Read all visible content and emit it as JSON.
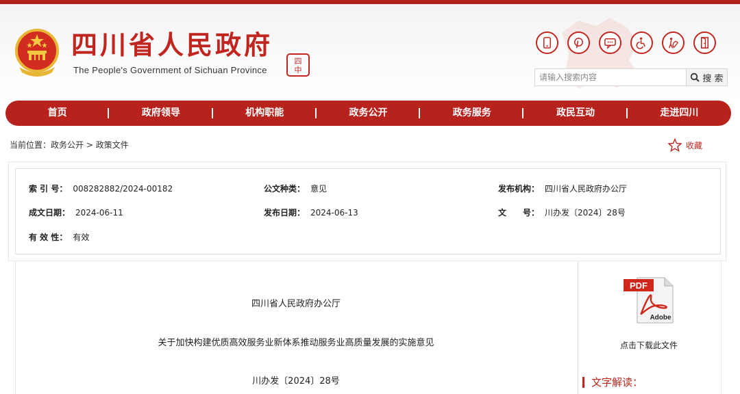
{
  "header": {
    "title": "四川省人民政府",
    "subtitle": "The People's Government of Sichuan Province",
    "seal_chars": [
      "四",
      "川",
      "中",
      "國"
    ],
    "brand_color": "#c0261f",
    "tools": [
      {
        "icon": "mobile-icon"
      },
      {
        "icon": "pinterest-icon"
      },
      {
        "icon": "chat-icon"
      },
      {
        "icon": "accessibility-icon"
      },
      {
        "icon": "elderly-care-icon"
      },
      {
        "icon": "exit-door-icon"
      }
    ],
    "search": {
      "placeholder": "请输入搜索内容",
      "button_label": "搜 索"
    }
  },
  "nav": {
    "items": [
      "首页",
      "政府领导",
      "机构职能",
      "政务公开",
      "政务服务",
      "政民互动",
      "走进四川"
    ],
    "background": "#b8221c"
  },
  "breadcrumb": {
    "prefix": "当前位置：",
    "items": [
      "政务公开",
      "政策文件"
    ],
    "separator": ">"
  },
  "favorite": {
    "label": "收藏",
    "icon": "star-icon"
  },
  "meta": {
    "index_no": {
      "label": "索 引 号：",
      "value": "008282882/2024-00182"
    },
    "doc_type": {
      "label": "公文种类：",
      "value": "意见"
    },
    "issuer": {
      "label": "发布机构：",
      "value": "四川省人民政府办公厅"
    },
    "created_date": {
      "label": "成文日期：",
      "value": "2024-06-11"
    },
    "publish_date": {
      "label": "发布日期：",
      "value": "2024-06-13"
    },
    "doc_no": {
      "label": "文　　号：",
      "value": "川办发〔2024〕28号"
    },
    "validity": {
      "label": "有 效 性：",
      "value": "有效"
    }
  },
  "document": {
    "issuer": "四川省人民政府办公厅",
    "title": "关于加快构建优质高效服务业新体系推动服务业高质量发展的实施意见",
    "doc_no": "川办发〔2024〕28号"
  },
  "sidebar": {
    "pdf_icon": "pdf-adobe-icon",
    "pdf_text": "PDF",
    "pdf_brand": "Adobe",
    "download_label": "点击下载此文件",
    "interpret_label": "文字解读："
  }
}
